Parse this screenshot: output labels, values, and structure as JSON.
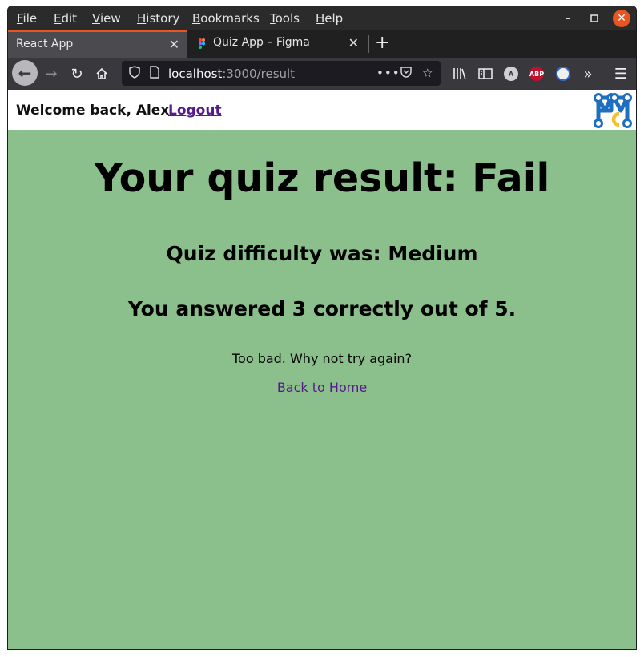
{
  "menubar": {
    "items": [
      "File",
      "Edit",
      "View",
      "History",
      "Bookmarks",
      "Tools",
      "Help"
    ]
  },
  "tabs": [
    {
      "label": "React App",
      "active": true
    },
    {
      "label": "Quiz App – Figma",
      "active": false
    }
  ],
  "url": {
    "host": "localhost",
    "path": ":3000/result"
  },
  "toolbar": {
    "icons": [
      "library-icon",
      "sidebar-icon",
      "account-icon",
      "adblock-icon",
      "extension-icon",
      "overflow-icon",
      "menu-icon"
    ],
    "adblock_label": "ABP",
    "account_label": "A"
  },
  "header": {
    "welcome": "Welcome back, Alex",
    "logout": "Logout"
  },
  "result": {
    "title": "Your quiz result: Fail",
    "difficulty": "Quiz difficulty was: Medium",
    "score": "You answered 3 correctly out of 5.",
    "message": "Too bad. Why not try again?",
    "home_link": "Back to Home"
  },
  "colors": {
    "page_background": "#8bbf8b",
    "accent": "#e95420",
    "link": "#551a8b",
    "logo_blue": "#1e6fc0",
    "logo_yellow": "#f2c230"
  }
}
